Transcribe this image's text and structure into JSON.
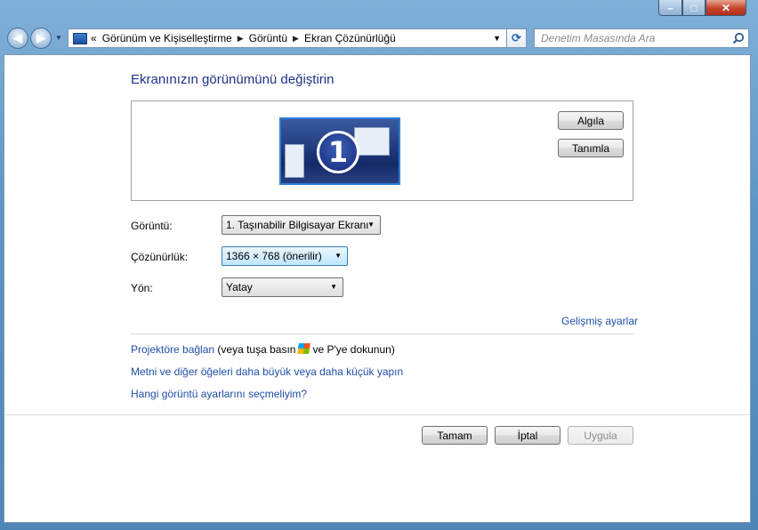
{
  "window": {
    "title": "",
    "controls": {
      "minimize": "–",
      "maximize": "□",
      "close": "✕"
    }
  },
  "nav": {
    "back_icon": "arrow-left-icon",
    "forward_icon": "arrow-right-icon",
    "breadcrumbs": [
      "Görünüm ve Kişiselleştirme",
      "Görüntü",
      "Ekran Çözünürlüğü"
    ],
    "overflow": "«",
    "search_placeholder": "Denetim Masasında Ara"
  },
  "main": {
    "heading": "Ekranınızın görünümünü değiştirin",
    "monitor_number": "1",
    "detect_button": "Algıla",
    "identify_button": "Tanımla",
    "display_label": "Görüntü:",
    "display_value": "1. Taşınabilir Bilgisayar Ekranı",
    "resolution_label": "Çözünürlük:",
    "resolution_value": "1366 × 768 (önerilir)",
    "orientation_label": "Yön:",
    "orientation_value": "Yatay",
    "advanced_link": "Gelişmiş ayarlar",
    "projector_link": "Projektöre bağlan",
    "projector_text_before": "(veya tuşa basın",
    "projector_text_after": "ve P'ye dokunun)",
    "text_size_link": "Metni ve diğer öğeleri daha büyük veya daha küçük yapın",
    "which_settings_link": "Hangi görüntü ayarlarını seçmeliyim?"
  },
  "footer": {
    "ok": "Tamam",
    "cancel": "İptal",
    "apply": "Uygula"
  },
  "colors": {
    "link": "#1e4fa5",
    "heading": "#1e3287",
    "monitor_border": "#2f7dd3",
    "close_button": "#c4442b"
  }
}
